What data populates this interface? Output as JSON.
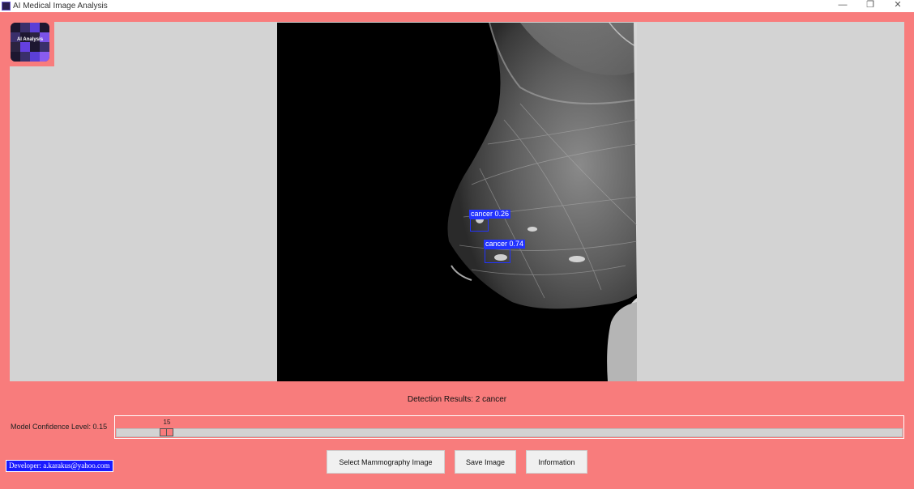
{
  "window": {
    "title": "AI Medical Image Analysis",
    "minimize_icon": "—",
    "maximize_icon": "❐",
    "close_icon": "✕"
  },
  "logo": {
    "text": "AI Analysis"
  },
  "image_viewer": {
    "detections": [
      {
        "label": "cancer 0.26",
        "confidence": 0.26
      },
      {
        "label": "cancer 0.74",
        "confidence": 0.74
      }
    ]
  },
  "results": {
    "text": "Detection Results: 2 cancer"
  },
  "confidence": {
    "label": "Model Confidence Level: 0.15",
    "slider_value": "15",
    "slider_level": 15
  },
  "developer": {
    "text": "Developer: a.karakus@yahoo.com"
  },
  "buttons": {
    "select": "Select  Mammography Image",
    "save": "Save Image",
    "info": "Information"
  },
  "colors": {
    "background": "#f87c7c",
    "panel": "#d3d3d3",
    "detection": "#2233ff",
    "developer_badge": "#1a1aff"
  }
}
